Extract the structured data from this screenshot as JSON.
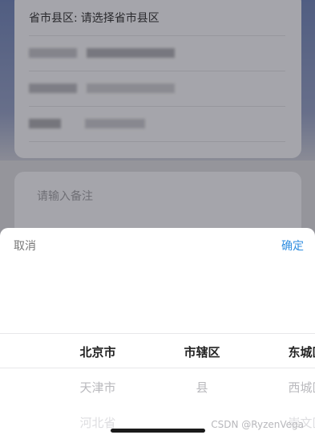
{
  "form": {
    "region_label": "省市县区:",
    "region_value": "请选择省市县区",
    "note_placeholder": "请输入备注"
  },
  "picker": {
    "cancel_label": "取消",
    "confirm_label": "确定",
    "columns": [
      {
        "options": [
          "北京市",
          "天津市",
          "河北省"
        ]
      },
      {
        "options": [
          "市辖区",
          "县",
          ""
        ]
      },
      {
        "options": [
          "东城区",
          "西城区",
          "崇文区"
        ]
      }
    ]
  },
  "watermark": "CSDN @RyzenVega"
}
